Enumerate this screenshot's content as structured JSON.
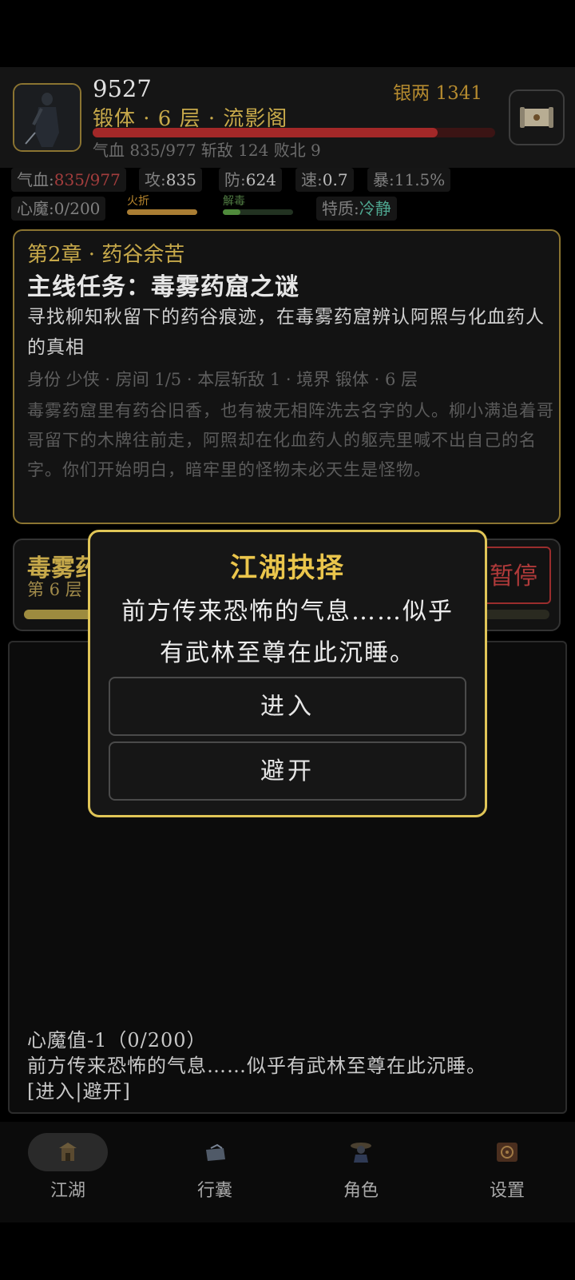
{
  "player": {
    "name": "9527",
    "realm": "锻体 · 6 层 · 流影阁",
    "silver_label": "银两 1341",
    "hp_fraction": 0.857,
    "summary": "气血 835/977   斩敌 124   败北 9"
  },
  "attributes": {
    "hp_label": "气血:",
    "hp_value": "835/977",
    "atk_label": "攻:",
    "atk_value": "835",
    "def_label": "防:",
    "def_value": "624",
    "spd_label": "速:",
    "spd_value": "0.7",
    "crit_label": "暴:",
    "crit_value": "11.5%",
    "demon_label": "心魔:",
    "demon_value": "0/200",
    "fire_label": "火折",
    "antidote_label": "解毒",
    "trait_label": "特质:",
    "trait_value": "冷静"
  },
  "quest": {
    "chapter": "第2章 · 药谷余苦",
    "title": "主线任务：毒雾药窟之谜",
    "description": "寻找柳知秋留下的药谷痕迹，在毒雾药窟辨认阿照与化血药人的真相",
    "meta": "身份 少侠 · 房间 1/5 · 本层斩敌 1 · 境界 锻体 · 6 层",
    "story": "毒雾药窟里有药谷旧香，也有被无相阵洗去名字的人。柳小满追着哥哥留下的木牌往前走，阿照却在化血药人的躯壳里喊不出自己的名字。你们开始明白，暗牢里的怪物未必天生是怪物。"
  },
  "dungeon": {
    "name": "毒雾药",
    "floor": "第 6 层",
    "pause_label": "暂停"
  },
  "log": {
    "lines": [
      "心魔值-1（0/200）",
      "前方传来恐怖的气息……似乎有武林至尊在此沉睡。",
      "[进入|避开]"
    ]
  },
  "modal": {
    "title": "江湖抉择",
    "message": "前方传来恐怖的气息……似乎有武林至尊在此沉睡。",
    "enter_label": "进入",
    "avoid_label": "避开"
  },
  "nav": {
    "items": [
      {
        "label": "江湖",
        "icon": "jianghu-icon"
      },
      {
        "label": "行囊",
        "icon": "bag-icon"
      },
      {
        "label": "角色",
        "icon": "character-icon"
      },
      {
        "label": "设置",
        "icon": "settings-icon"
      }
    ],
    "active": 0
  },
  "colors": {
    "gold": "#c7a94a",
    "modal_border": "#e0c557",
    "hp_bar": "#a32828",
    "danger": "#b03a3a"
  }
}
